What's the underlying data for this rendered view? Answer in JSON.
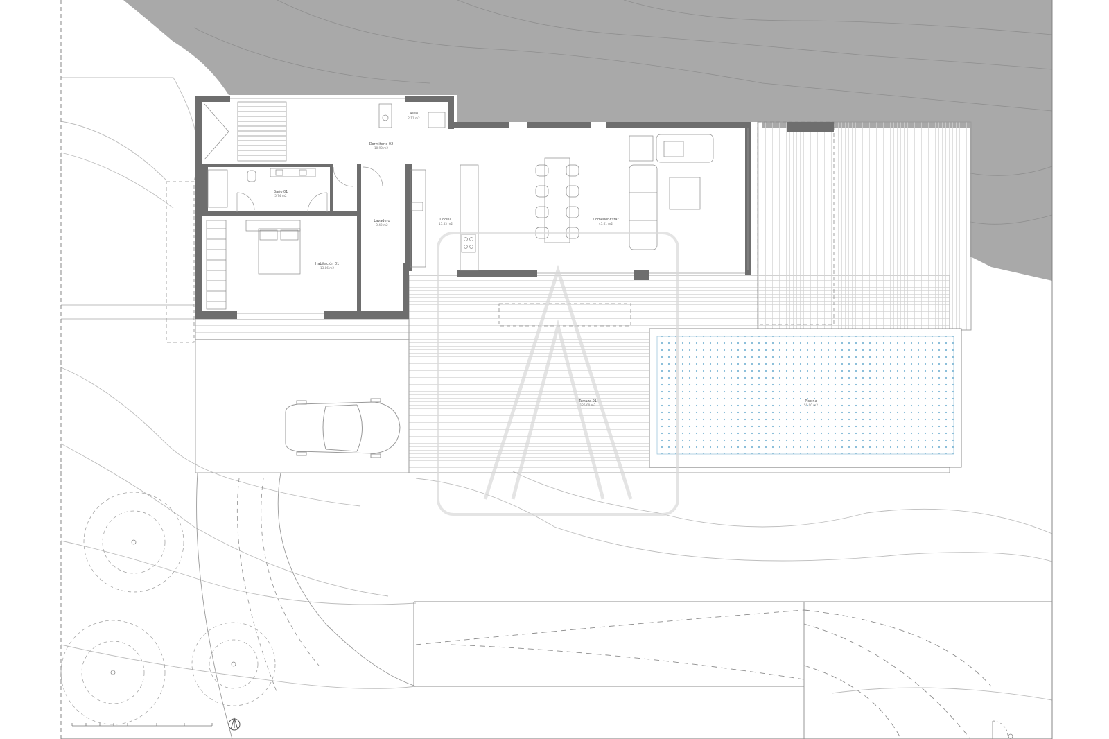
{
  "plan": {
    "rooms": [
      {
        "key": "aseo",
        "name": "Aseo",
        "area": "2.11 m2"
      },
      {
        "key": "dormitorio02",
        "name": "Dormitorio 02",
        "area": "10.90 m2"
      },
      {
        "key": "bano01",
        "name": "Baño 01",
        "area": "5.74 m2"
      },
      {
        "key": "lavadero",
        "name": "Lavadero",
        "area": "3.42 m2"
      },
      {
        "key": "cocina",
        "name": "Cocina",
        "area": "15.53 m2"
      },
      {
        "key": "comedor",
        "name": "Comedor-Estar",
        "area": "45.61 m2"
      },
      {
        "key": "habitacion01",
        "name": "Habitación 01",
        "area": "13.86 m2"
      },
      {
        "key": "terraza01",
        "name": "Terraza 01",
        "area": "125.00 m2"
      },
      {
        "key": "piscina",
        "name": "Piscina",
        "area": "50.00 m2"
      }
    ]
  },
  "colors": {
    "terrain": "#a9a9a9",
    "wall": "#6e6e6e",
    "line": "#8c8c8c",
    "pool_dot": "#7fb8d6",
    "watermark": "#d9d9d9"
  },
  "icons": [
    "north-arrow-icon",
    "car-icon",
    "watermark-logo-icon"
  ]
}
